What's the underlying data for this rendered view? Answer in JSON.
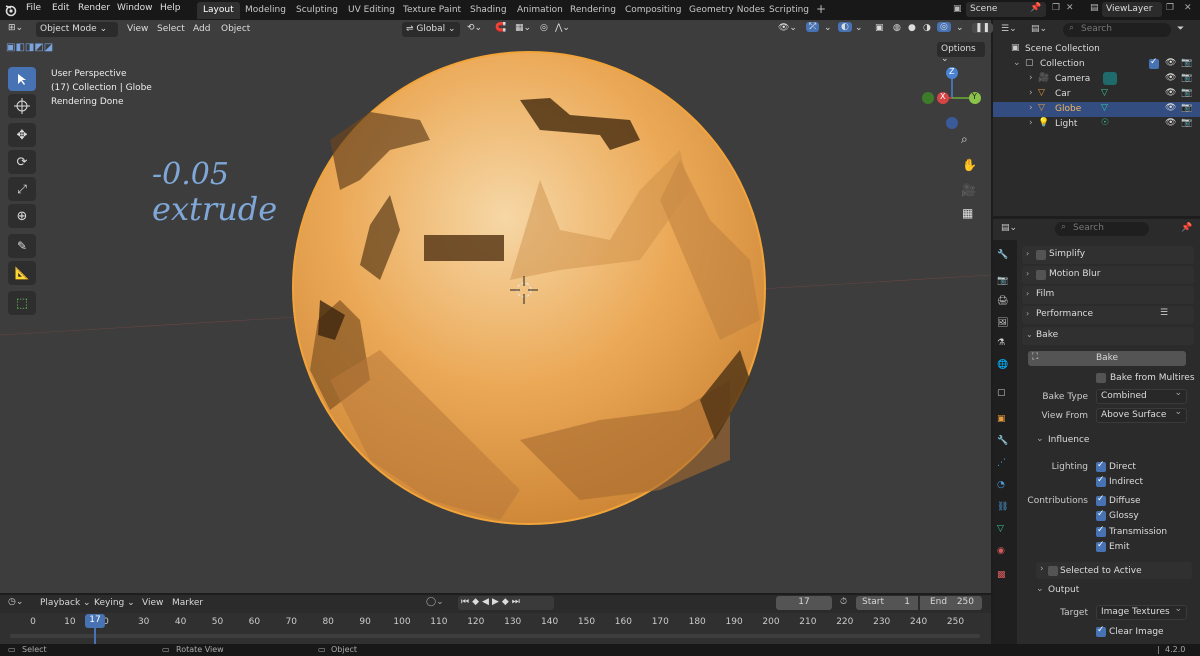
{
  "menu": [
    "File",
    "Edit",
    "Render",
    "Window",
    "Help"
  ],
  "workspaces": [
    "Layout",
    "Modeling",
    "Sculpting",
    "UV Editing",
    "Texture Paint",
    "Shading",
    "Animation",
    "Rendering",
    "Compositing",
    "Geometry Nodes",
    "Scripting"
  ],
  "active_workspace": "Layout",
  "scene": "Scene",
  "view_layer": "ViewLayer",
  "viewport": {
    "mode": "Object Mode",
    "menus": [
      "View",
      "Select",
      "Add",
      "Object"
    ],
    "orientation": "Global",
    "overlay_info": [
      "User Perspective",
      "(17) Collection | Globe",
      "Rendering Done"
    ],
    "options_label": "Options",
    "note_line1": "-0.05",
    "note_line2": "extrude",
    "gizmo_axes": {
      "z": "Z",
      "x": "X",
      "y": "Y"
    }
  },
  "outliner": {
    "search_placeholder": "Search",
    "root": "Scene Collection",
    "collection": "Collection",
    "items": [
      {
        "name": "Camera",
        "selected": false
      },
      {
        "name": "Car",
        "selected": false
      },
      {
        "name": "Globe",
        "selected": true
      },
      {
        "name": "Light",
        "selected": false
      }
    ]
  },
  "properties": {
    "search_placeholder": "Search",
    "panels": {
      "simplify": "Simplify",
      "motion_blur": "Motion Blur",
      "film": "Film",
      "performance": "Performance",
      "bake": "Bake"
    },
    "bake_button": "Bake",
    "bake_from_multires": "Bake from Multires",
    "bake_type_label": "Bake Type",
    "bake_type_value": "Combined",
    "view_from_label": "View From",
    "view_from_value": "Above Surface",
    "influence": "Influence",
    "lighting_label": "Lighting",
    "direct": "Direct",
    "indirect": "Indirect",
    "contributions_label": "Contributions",
    "diffuse": "Diffuse",
    "glossy": "Glossy",
    "transmission": "Transmission",
    "emit": "Emit",
    "selected_to_active": "Selected to Active",
    "output": "Output",
    "target_label": "Target",
    "target_value": "Image Textures",
    "clear_image": "Clear Image"
  },
  "timeline": {
    "menus": [
      "Playback",
      "Keying",
      "View",
      "Marker"
    ],
    "current_frame": "17",
    "start_label": "Start",
    "start": "1",
    "end_label": "End",
    "end": "250",
    "ticks": [
      "0",
      "10",
      "17",
      "0",
      "30",
      "40",
      "50",
      "60",
      "70",
      "80",
      "90",
      "100",
      "110",
      "120",
      "130",
      "140",
      "150",
      "160",
      "170",
      "180",
      "190",
      "200",
      "210",
      "220",
      "230",
      "240",
      "250"
    ]
  },
  "status": {
    "select": "Select",
    "rotate": "Rotate View",
    "object": "Object",
    "version": "4.2.0"
  },
  "colors": {
    "accent": "#4772b3",
    "selection_outline": "#f2a43a",
    "globe": "#e8a44a",
    "note_ink": "#7fa8d8"
  }
}
